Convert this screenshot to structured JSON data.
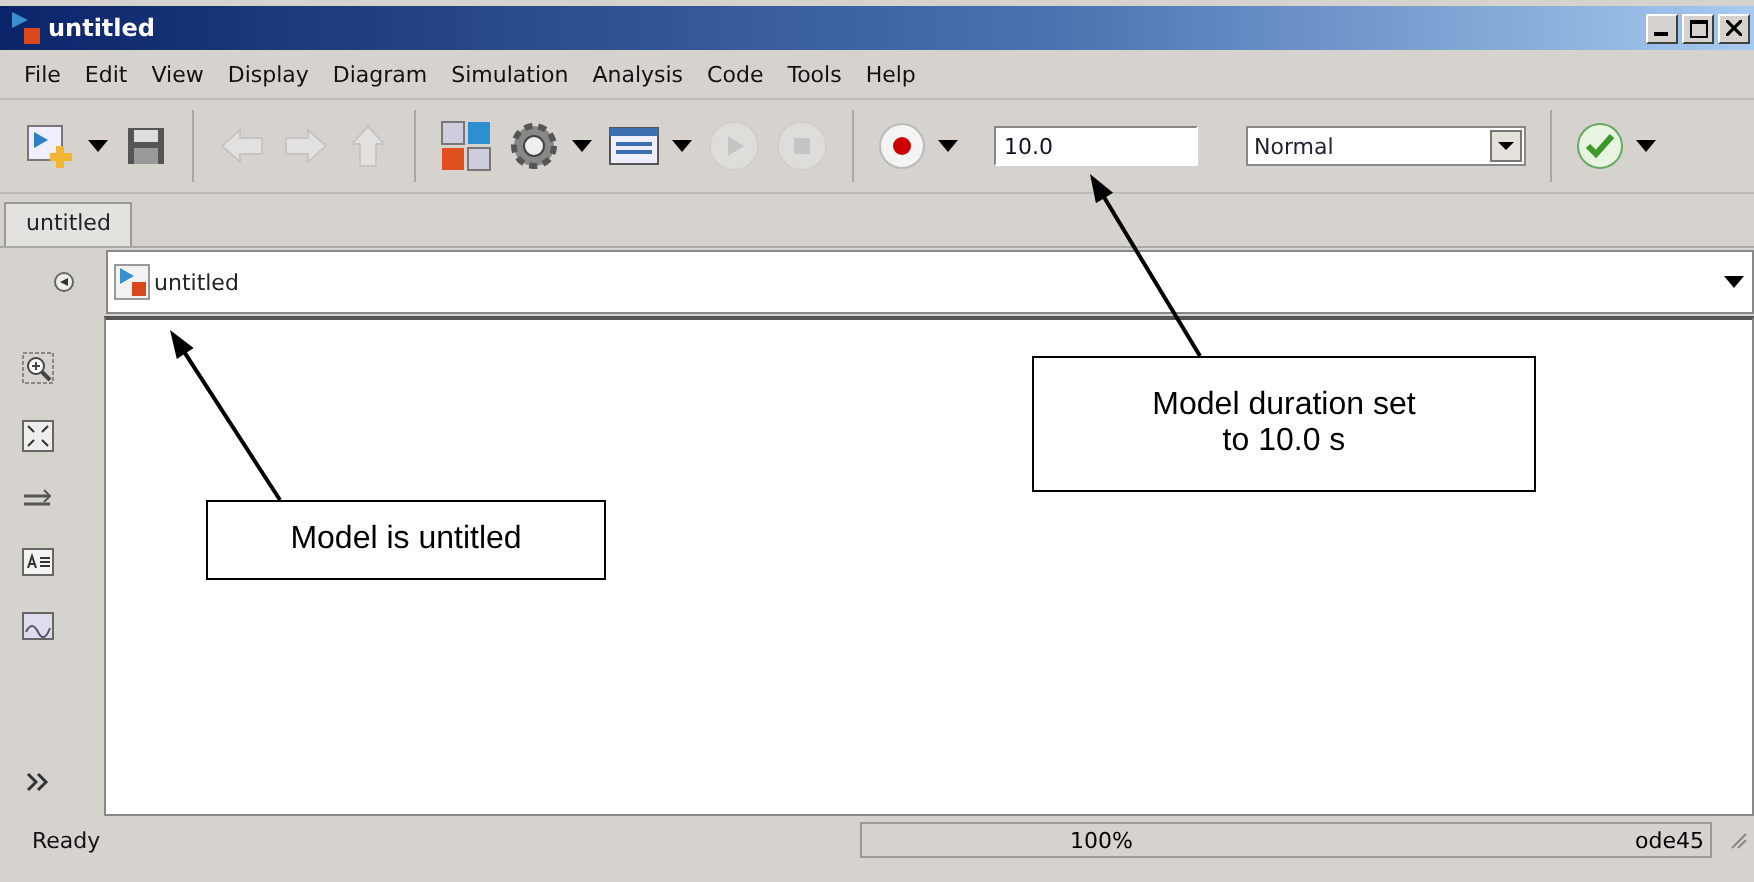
{
  "window": {
    "title": "untitled"
  },
  "menu": [
    "File",
    "Edit",
    "View",
    "Display",
    "Diagram",
    "Simulation",
    "Analysis",
    "Code",
    "Tools",
    "Help"
  ],
  "toolbar": [
    {
      "kind": "new-model",
      "menu": true,
      "disabled": false
    },
    {
      "kind": "save",
      "menu": false,
      "disabled": false
    },
    {
      "kind": "sep"
    },
    {
      "kind": "back",
      "menu": false,
      "disabled": true
    },
    {
      "kind": "forward",
      "menu": false,
      "disabled": true
    },
    {
      "kind": "up",
      "menu": false,
      "disabled": true
    },
    {
      "kind": "sep"
    },
    {
      "kind": "library",
      "menu": false,
      "disabled": false
    },
    {
      "kind": "settings",
      "menu": true,
      "disabled": false
    },
    {
      "kind": "explorer",
      "menu": true,
      "disabled": false
    },
    {
      "kind": "run",
      "menu": false,
      "disabled": true
    },
    {
      "kind": "stop",
      "menu": false,
      "disabled": true
    },
    {
      "kind": "sep"
    },
    {
      "kind": "record",
      "menu": true,
      "disabled": false
    },
    {
      "kind": "stop-time",
      "value": "10.0"
    },
    {
      "kind": "mode",
      "value": "Normal"
    },
    {
      "kind": "sep"
    },
    {
      "kind": "check",
      "menu": true,
      "disabled": false
    }
  ],
  "tabs": [
    {
      "label": "untitled",
      "selected": true
    }
  ],
  "breadcrumb": "untitled",
  "annotations": [
    {
      "text": "Model duration set\nto 10.0 s"
    },
    {
      "text": "Model is untitled"
    }
  ],
  "status_bar": {
    "status": "Ready",
    "zoom": "100%",
    "solver": "ode45"
  }
}
